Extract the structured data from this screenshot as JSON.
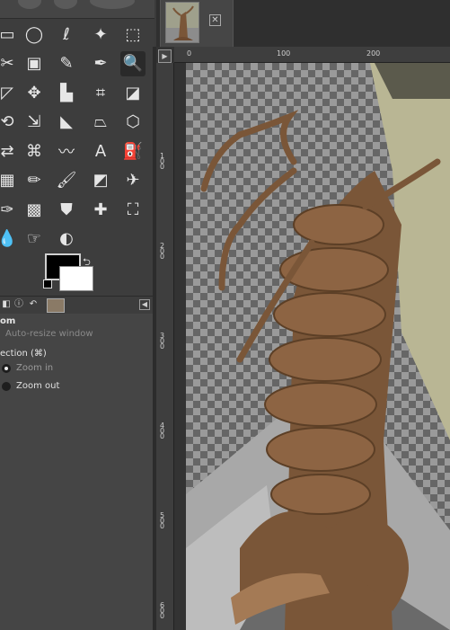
{
  "image_tab": {
    "close_icon": "close-icon"
  },
  "toolbox": {
    "tools": [
      "rect-select-icon",
      "ellipse-select-icon",
      "free-select-icon",
      "fuzzy-select-icon",
      "select-by-color-icon",
      "scissors-select-icon",
      "foreground-select-icon",
      "paths-icon",
      "color-picker-icon",
      "zoom-icon",
      "measure-icon",
      "move-icon",
      "align-icon",
      "crop-icon",
      "unified-transform-icon",
      "rotate-icon",
      "scale-icon",
      "shear-icon",
      "perspective-icon",
      "3d-transform-icon",
      "flip-icon",
      "cage-transform-icon",
      "warp-transform-icon",
      "text-icon",
      "bucket-fill-icon",
      "gradient-icon",
      "pencil-icon",
      "paintbrush-icon",
      "eraser-icon",
      "airbrush-icon",
      "ink-icon",
      "mypaint-brush-icon",
      "clone-icon",
      "heal-icon",
      "perspective-clone-icon",
      "blur-icon",
      "smudge-icon",
      "dodge-burn-icon"
    ],
    "selected_tool": "zoom-icon",
    "foreground_color": "#000000",
    "background_color": "#ffffff"
  },
  "tool_options": {
    "title": "om",
    "auto_resize_label": "Auto-resize window",
    "direction_label": "ection  (⌘)",
    "zoom_in_label": "Zoom in",
    "zoom_out_label": "Zoom out",
    "selected_direction": "zoom-in"
  },
  "rulers": {
    "horizontal": [
      "0",
      "100",
      "200"
    ],
    "vertical": [
      "100",
      "200",
      "300",
      "400",
      "500",
      "600"
    ]
  }
}
